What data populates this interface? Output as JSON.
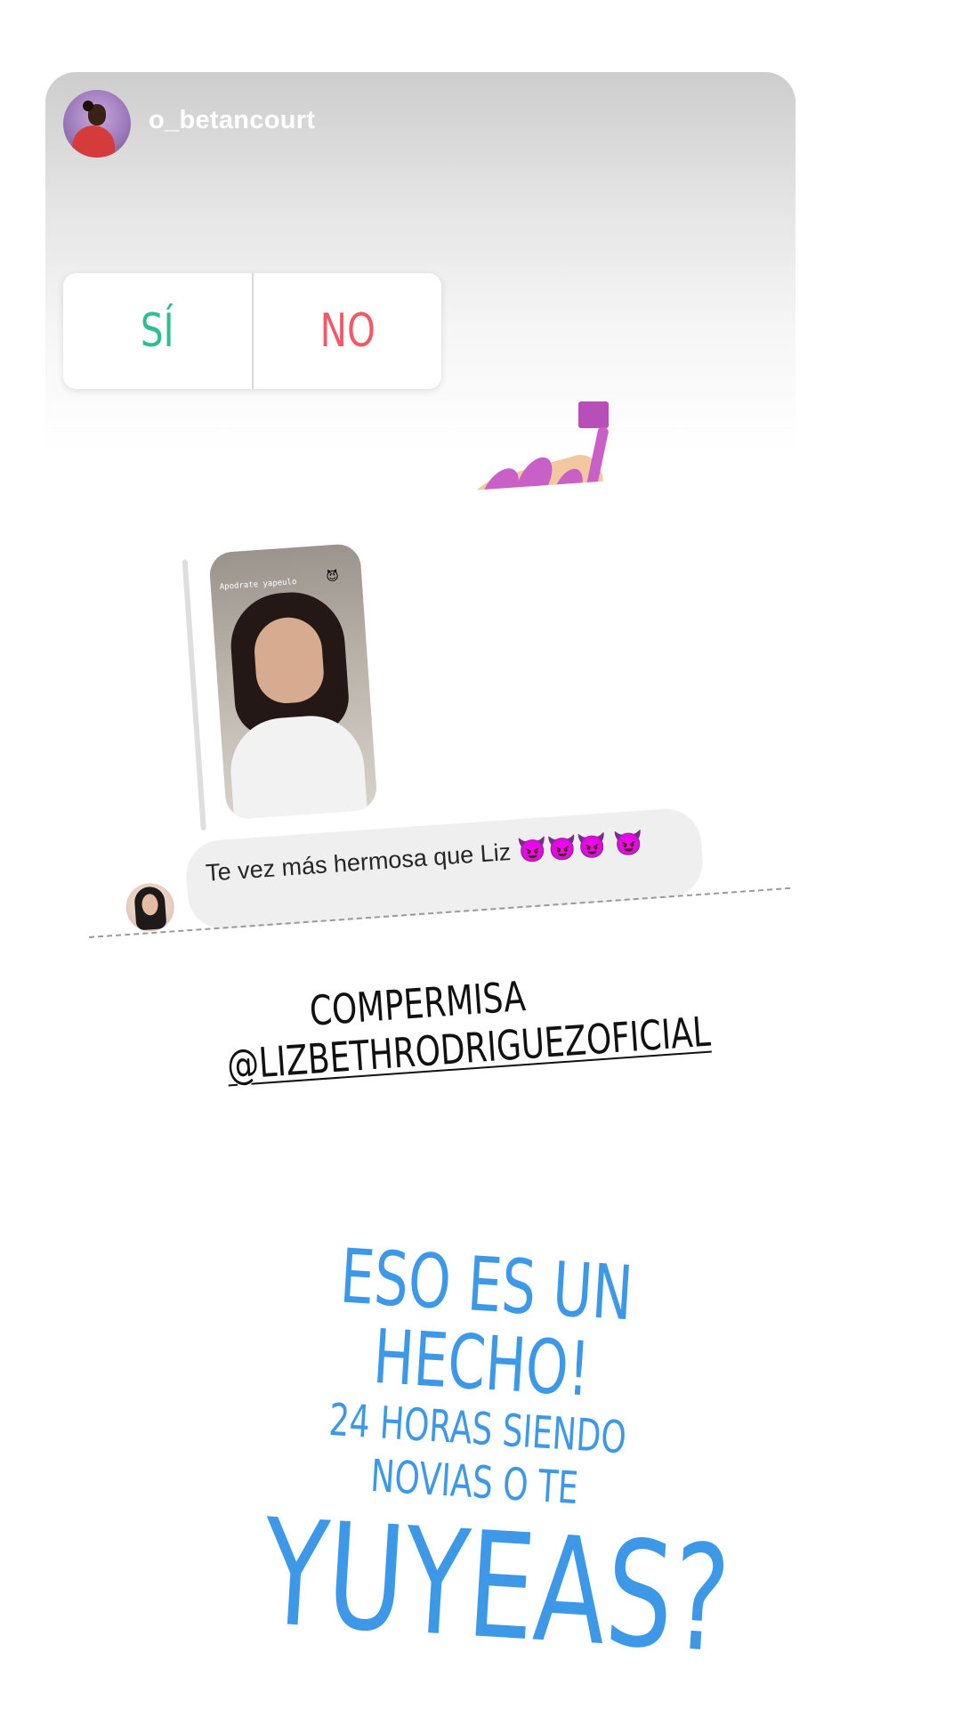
{
  "story": {
    "username": "o_betancourt",
    "poll": {
      "yes_label": "SÍ",
      "no_label": "NO"
    },
    "sticker_icon": "nail-polish-emoji",
    "reply": {
      "thumbnail_caption": "Apodrate yapeulo",
      "thumbnail_emoji": "😈",
      "message": "Te vez más hermosa que Liz 😈😈😈 😈"
    }
  },
  "caption": {
    "line1": "COMPERMISA",
    "line2": "@LIZBETHRODRIGUEZOFICIAL"
  },
  "question": {
    "line1": "ESO ES UN HECHO!",
    "line2": "24 HORAS SIENDO NOVIAS O TE",
    "line3": "YUYEAS?"
  },
  "colors": {
    "yes": "#2fbf8e",
    "no": "#ef5a68",
    "question": "#3d98e8"
  }
}
